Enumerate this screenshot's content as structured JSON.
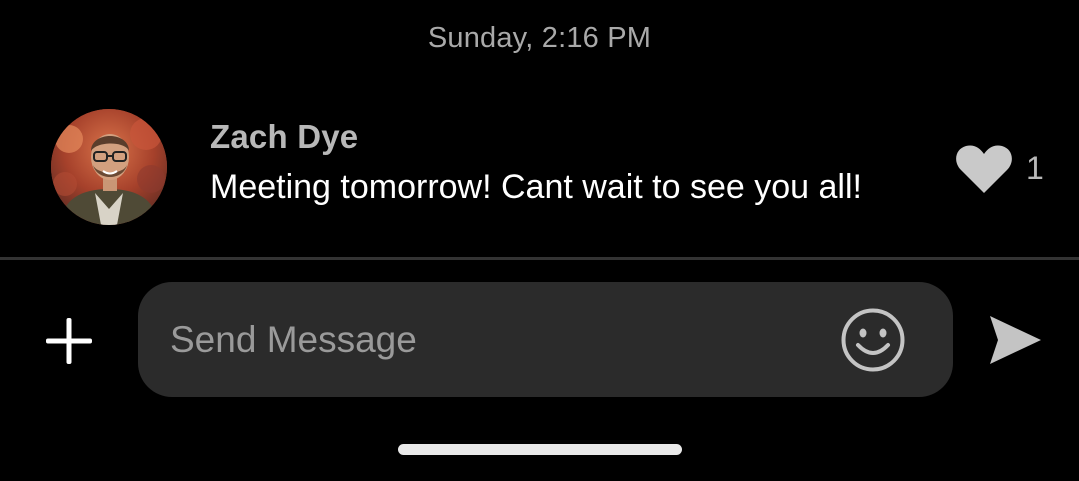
{
  "conversation": {
    "timestamp": "Sunday, 2:16 PM"
  },
  "message": {
    "sender": "Zach Dye",
    "text": "Meeting tomorrow! Cant wait to see you all!",
    "like_count": "1",
    "avatar_icon": "user-photo-avatar",
    "like_icon": "heart-icon"
  },
  "composer": {
    "placeholder": "Send Message",
    "value": "",
    "add_icon": "plus-icon",
    "emoji_icon": "smiley-face-icon",
    "send_icon": "paper-plane-send-icon"
  },
  "colors": {
    "background": "#000000",
    "timestamp_text": "#a9a9a9",
    "sender_text": "#b8b8b8",
    "message_text": "#ffffff",
    "input_background": "#2b2b2b",
    "placeholder_text": "#9a9a9a",
    "icon_gray": "#c4c4c4",
    "divider": "#333333"
  }
}
